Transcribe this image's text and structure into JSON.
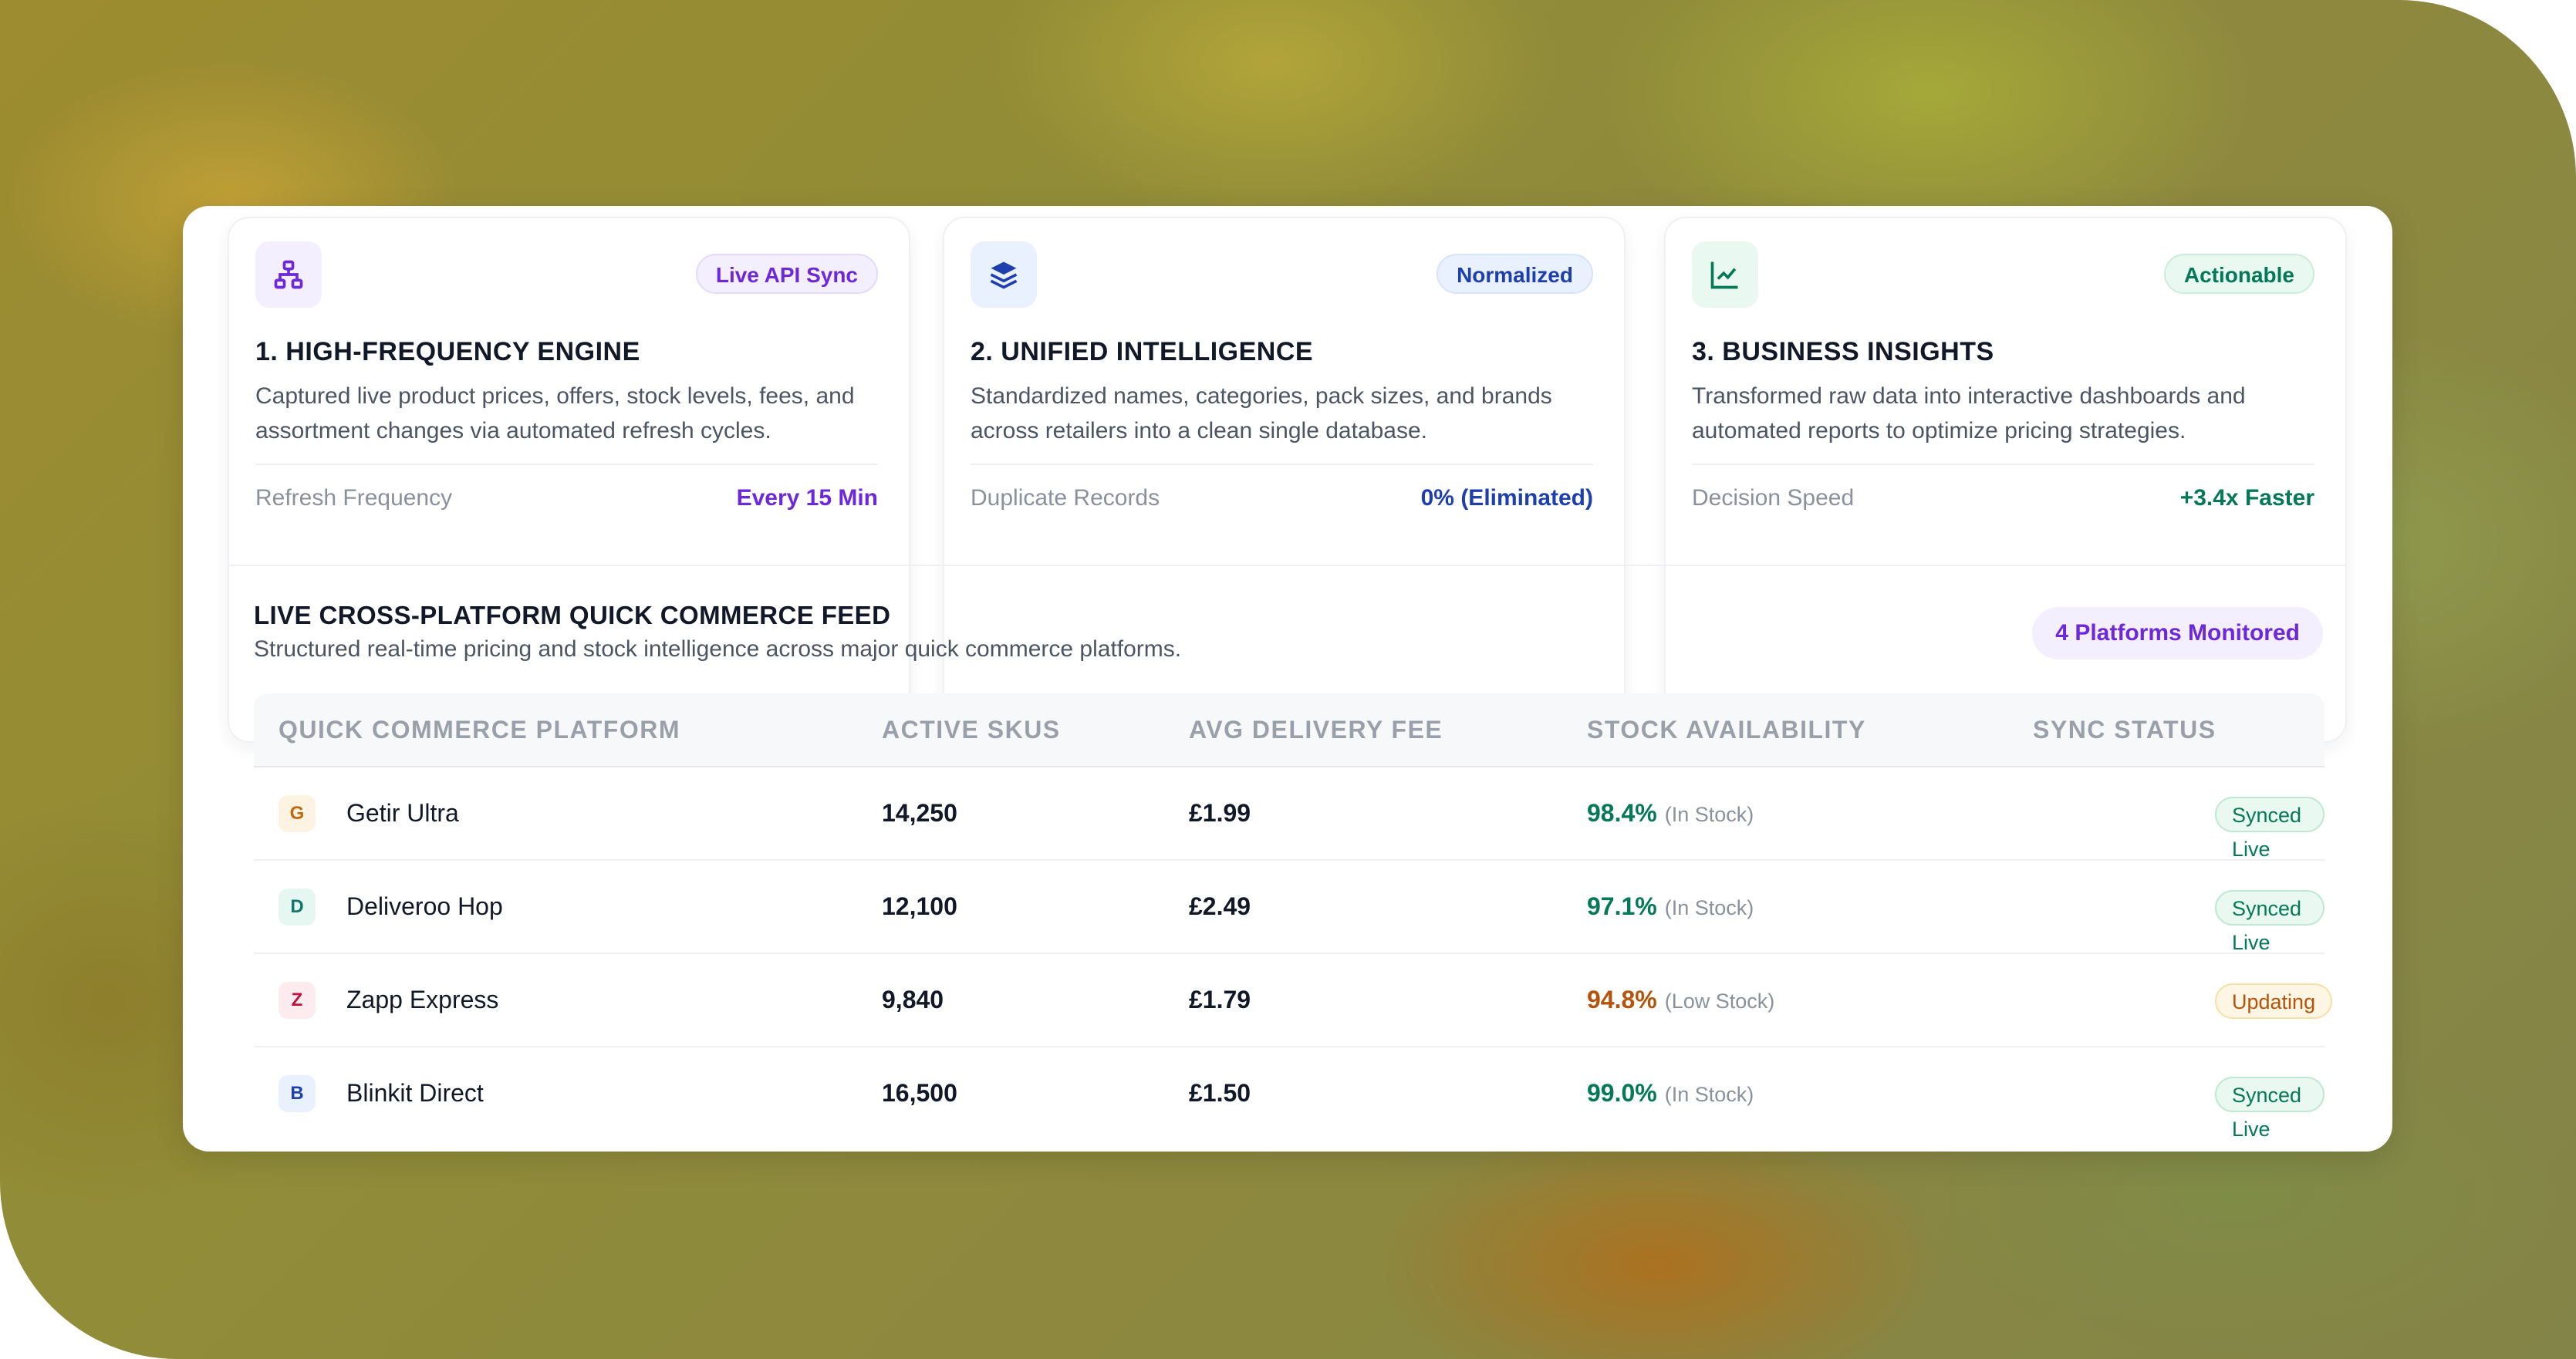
{
  "features": [
    {
      "badge": "Live API Sync",
      "title": "1. HIGH-FREQUENCY ENGINE",
      "desc": "Captured live product prices, offers, stock levels, fees, and assortment changes via automated refresh cycles.",
      "metric_label": "Refresh Frequency",
      "metric_value": "Every 15 Min",
      "icon": "network-icon",
      "accent": "#6d28d9"
    },
    {
      "badge": "Normalized",
      "title": "2. UNIFIED INTELLIGENCE",
      "desc": "Standardized names, categories, pack sizes, and brands across retailers into a clean single database.",
      "metric_label": "Duplicate Records",
      "metric_value": "0% (Eliminated)",
      "icon": "layers-icon",
      "accent": "#1e40af"
    },
    {
      "badge": "Actionable",
      "title": "3. BUSINESS INSIGHTS",
      "desc": "Transformed raw data into interactive dashboards and automated reports to optimize pricing strategies.",
      "metric_label": "Decision Speed",
      "metric_value": "+3.4x Faster",
      "icon": "chart-line-icon",
      "accent": "#047857"
    }
  ],
  "feed": {
    "title": "LIVE CROSS-PLATFORM QUICK COMMERCE FEED",
    "subtitle": "Structured real-time pricing and stock intelligence across major quick commerce platforms.",
    "badge": "4 Platforms Monitored",
    "columns": [
      "QUICK COMMERCE PLATFORM",
      "ACTIVE SKUS",
      "AVG DELIVERY FEE",
      "STOCK AVAILABILITY",
      "SYNC STATUS"
    ],
    "rows": [
      {
        "initial": "G",
        "name": "Getir Ultra",
        "skus": "14,250",
        "fee": "£1.99",
        "stock": "98.4%",
        "stock_note": "(In Stock)",
        "status": "Synced Live"
      },
      {
        "initial": "D",
        "name": "Deliveroo Hop",
        "skus": "12,100",
        "fee": "£2.49",
        "stock": "97.1%",
        "stock_note": "(In Stock)",
        "status": "Synced Live"
      },
      {
        "initial": "Z",
        "name": "Zapp Express",
        "skus": "9,840",
        "fee": "£1.79",
        "stock": "94.8%",
        "stock_note": "(Low Stock)",
        "status": "Updating"
      },
      {
        "initial": "B",
        "name": "Blinkit Direct",
        "skus": "16,500",
        "fee": "£1.50",
        "stock": "99.0%",
        "stock_note": "(In Stock)",
        "status": "Synced Live"
      }
    ]
  }
}
